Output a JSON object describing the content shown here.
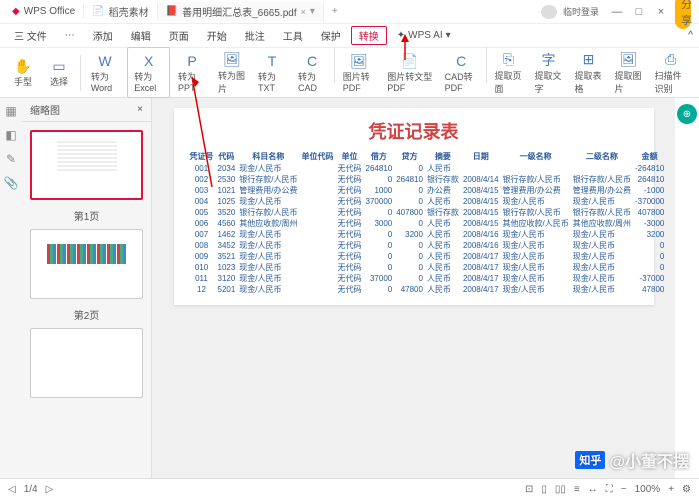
{
  "titlebar": {
    "app": "WPS Office",
    "tabs": [
      {
        "icon": "📄",
        "label": "稻壳素材"
      },
      {
        "icon": "📕",
        "label": "善用明细汇总表_6665.pdf",
        "active": true
      }
    ],
    "user": "临时登录",
    "vip": "分享"
  },
  "menubar": {
    "items": [
      "三 文件",
      "⋯",
      "添加",
      "编辑",
      "页面",
      "开始",
      "批注",
      "工具",
      "保护"
    ],
    "highlight": "转换",
    "ai": "WPS AI"
  },
  "toolbar": {
    "left": [
      {
        "icon": "✋",
        "label": "手型"
      },
      {
        "icon": "▭",
        "label": "选择"
      }
    ],
    "main": [
      {
        "icon": "W",
        "label": "转为Word"
      },
      {
        "icon": "X",
        "label": "转为Excel",
        "boxed": true
      },
      {
        "icon": "P",
        "label": "转为PPT"
      },
      {
        "icon": "🖼",
        "label": "转为图片"
      },
      {
        "icon": "T",
        "label": "转为TXT"
      },
      {
        "icon": "C",
        "label": "转为CAD"
      },
      {
        "icon": "🖼",
        "label": "图片转PDF"
      },
      {
        "icon": "📄",
        "label": "图片转文型PDF"
      },
      {
        "icon": "C",
        "label": "CAD转PDF"
      },
      {
        "icon": "⎘",
        "label": "提取页面"
      },
      {
        "icon": "字",
        "label": "提取文字"
      },
      {
        "icon": "⊞",
        "label": "提取表格"
      },
      {
        "icon": "🖼",
        "label": "提取图片"
      },
      {
        "icon": "⎙",
        "label": "扫描件识别"
      }
    ]
  },
  "thumbs": {
    "title": "缩略图",
    "pages": [
      {
        "label": "第1页"
      },
      {
        "label": "第2页"
      }
    ]
  },
  "doc": {
    "title": "凭证记录表",
    "headers": [
      "凭证号",
      "代码",
      "科目名称",
      "单位代码",
      "单位",
      "借方",
      "贷方",
      "摘要",
      "日期",
      "一级名称",
      "二级名称",
      "金额"
    ],
    "rows": [
      [
        "001",
        "2034",
        "现金/人民币",
        "",
        "无代码",
        "264810",
        "0",
        "人民币",
        "",
        "",
        "",
        "-264810"
      ],
      [
        "002",
        "2530",
        "银行存款/人民币",
        "",
        "无代码",
        "0",
        "264810",
        "银行存款",
        "2008/4/14",
        "银行存款/人民币",
        "银行存款/人民币",
        "264810"
      ],
      [
        "003",
        "1021",
        "管理费用/办公费",
        "",
        "无代码",
        "1000",
        "0",
        "办公费",
        "2008/4/15",
        "管理费用/办公费",
        "管理费用/办公费",
        "-1000"
      ],
      [
        "004",
        "1025",
        "现金/人民币",
        "",
        "无代码",
        "370000",
        "0",
        "人民币",
        "2008/4/15",
        "现金/人民币",
        "现金/人民币",
        "-370000"
      ],
      [
        "005",
        "3520",
        "银行存款/人民币",
        "",
        "无代码",
        "0",
        "407800",
        "银行存款",
        "2008/4/15",
        "银行存款/人民币",
        "银行存款/人民币",
        "407800"
      ],
      [
        "006",
        "4560",
        "其他应收款/周州",
        "",
        "无代码",
        "3000",
        "0",
        "人民币",
        "2008/4/15",
        "其他应收款/人民币",
        "其他应收款/周州",
        "-3000"
      ],
      [
        "007",
        "1462",
        "现金/人民币",
        "",
        "无代码",
        "0",
        "3200",
        "人民币",
        "2008/4/16",
        "现金/人民币",
        "现金/人民币",
        "3200"
      ],
      [
        "008",
        "3452",
        "现金/人民币",
        "",
        "无代码",
        "0",
        "0",
        "人民币",
        "2008/4/16",
        "现金/人民币",
        "现金/人民币",
        "0"
      ],
      [
        "009",
        "3521",
        "现金/人民币",
        "",
        "无代码",
        "0",
        "0",
        "人民币",
        "2008/4/17",
        "现金/人民币",
        "现金/人民币",
        "0"
      ],
      [
        "010",
        "1023",
        "现金/人民币",
        "",
        "无代码",
        "0",
        "0",
        "人民币",
        "2008/4/17",
        "现金/人民币",
        "现金/人民币",
        "0"
      ],
      [
        "011",
        "3120",
        "现金/人民币",
        "",
        "无代码",
        "37000",
        "0",
        "人民币",
        "2008/4/17",
        "现金/人民币",
        "现金/人民币",
        "-37000"
      ],
      [
        "12",
        "5201",
        "现金/人民币",
        "",
        "无代码",
        "0",
        "47800",
        "人民币",
        "2008/4/17",
        "现金/人民币",
        "现金/人民币",
        "47800"
      ]
    ]
  },
  "status": {
    "page": "1/4",
    "zoom": "100%"
  },
  "watermark": {
    "brand": "知乎",
    "author": "@小董不摆"
  }
}
